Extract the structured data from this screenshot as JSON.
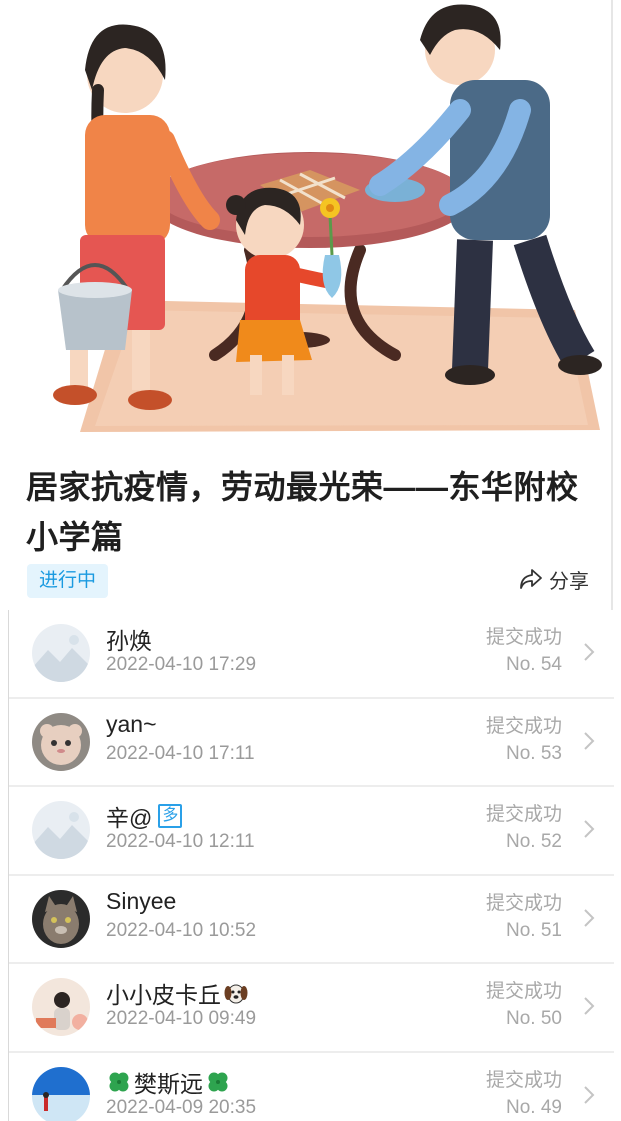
{
  "article": {
    "title": "居家抗疫情，劳动最光荣——东华附校小学篇",
    "status_badge": "进行中",
    "share_label": "分享"
  },
  "submissions": [
    {
      "name": "孙焕",
      "time": "2022-04-10 17:29",
      "status": "提交成功",
      "number": "No. 54",
      "avatar": "placeholder-avatar"
    },
    {
      "name": "yan~",
      "time": "2022-04-10 17:11",
      "status": "提交成功",
      "number": "No. 53",
      "avatar": "cat-toy-avatar"
    },
    {
      "name": "辛@",
      "time": "2022-04-10 12:11",
      "status": "提交成功",
      "number": "No. 52",
      "avatar": "placeholder-avatar",
      "tag": "多"
    },
    {
      "name": "Sinyee",
      "time": "2022-04-10 10:52",
      "status": "提交成功",
      "number": "No. 51",
      "avatar": "cat-photo-avatar"
    },
    {
      "name": "小小皮卡丘",
      "time": "2022-04-10 09:49",
      "status": "提交成功",
      "number": "No. 50",
      "avatar": "girl-photo-avatar",
      "suffix_icon": "dog-emoji-icon"
    },
    {
      "name": "樊斯远",
      "time": "2022-04-09 20:35",
      "status": "提交成功",
      "number": "No. 49",
      "avatar": "beach-photo-avatar",
      "prefix_icon": "clover-emoji-icon",
      "suffix_icon": "clover-emoji-icon"
    }
  ],
  "colors": {
    "badge_text": "#1a9ae0",
    "badge_bg": "#e4f4fd",
    "muted_text": "#9a9a9a"
  }
}
